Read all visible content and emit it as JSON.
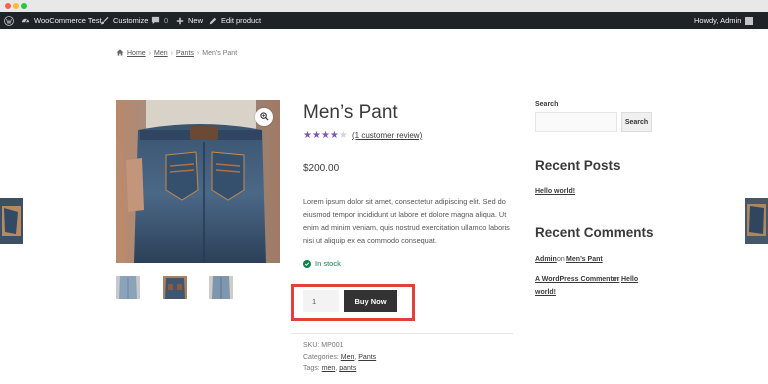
{
  "adminbar": {
    "site_name": "WooCommerce Test",
    "customize": "Customize",
    "comments_count": "0",
    "new": "New",
    "edit_product": "Edit product",
    "greeting": "Howdy, Admin"
  },
  "breadcrumb": {
    "home": "Home",
    "level1": "Men",
    "level2": "Pants",
    "current": "Men’s Pant"
  },
  "product": {
    "title": "Men’s Pant",
    "rating": 4,
    "rating_max": 5,
    "review_link": "(1 customer review)",
    "price": "$200.00",
    "description": "Lorem ipsum dolor sit amet, consectetur adipiscing elit. Sed do eiusmod tempor incididunt ut labore et dolore magna aliqua. Ut enim ad minim veniam, quis nostrud exercitation ullamco laboris nisi ut aliquip ex ea commodo consequat.",
    "stock": "In stock",
    "quantity": "1",
    "buy_button": "Buy Now",
    "sku_label": "SKU:",
    "sku": "MP001",
    "categories_label": "Categories:",
    "category1": "Men",
    "category2": "Pants",
    "tags_label": "Tags:",
    "tag1": "men",
    "tag2": "pants"
  },
  "sidebar": {
    "search_label": "Search",
    "search_button": "Search",
    "recent_posts_heading": "Recent Posts",
    "post1": "Hello world!",
    "recent_comments_heading": "Recent Comments",
    "comment1_author": "Admin",
    "comment1_on": "on",
    "comment1_post": "Men’s Pant",
    "comment2_author": "A WordPress Commenter",
    "comment2_on": "on",
    "comment2_post_line1": "Hello",
    "comment2_post_line2": "world!"
  },
  "colors": {
    "admin_bar": "#1d2327",
    "star_fill": "#7f54b3",
    "in_stock": "#0f834d",
    "buy_button": "#333333",
    "highlight": "#e2403b"
  },
  "icons": {
    "wordpress": "wordpress-icon",
    "site": "dashboard-icon",
    "customize": "brush-icon",
    "comments": "comment-icon",
    "new": "plus-icon",
    "edit": "pencil-icon",
    "home": "home-icon",
    "zoom": "zoom-icon",
    "stock": "check-circle-icon"
  }
}
